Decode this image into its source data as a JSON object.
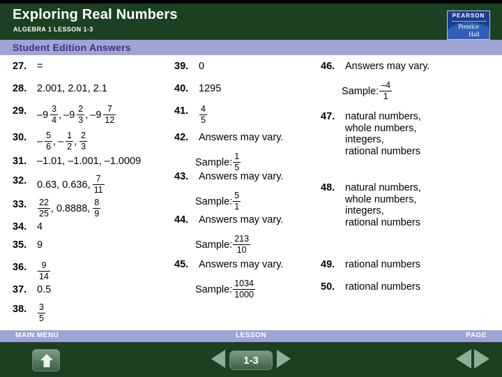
{
  "header": {
    "title": "Exploring Real Numbers",
    "subtitle": "ALGEBRA 1  LESSON 1-3",
    "logo": {
      "top_text": "PEARSON",
      "brand_line1": "Prentice",
      "brand_line2": "Hall",
      "bg_color": "#1b3f8f"
    },
    "bg_color": "#1d4023"
  },
  "band": {
    "label": "Student Edition Answers",
    "bg_color": "#9fa4d4",
    "text_color": "#4b2a8c"
  },
  "columns": [
    {
      "name": "column-1",
      "items": [
        {
          "num": "27.",
          "type": "text",
          "value": "="
        },
        {
          "num": "28.",
          "type": "text",
          "value": "2.001, 2.01, 2.1"
        },
        {
          "num": "29.",
          "type": "mixed-list",
          "parts": [
            {
              "whole": "–9",
              "n": "3",
              "d": "4",
              "sep": ","
            },
            {
              "whole": "–9",
              "n": "2",
              "d": "3",
              "sep": ","
            },
            {
              "whole": "–9",
              "n": "7",
              "d": "12",
              "sep": ""
            }
          ]
        },
        {
          "num": "30.",
          "type": "mixed-list",
          "parts": [
            {
              "whole": "–",
              "n": "5",
              "d": "6",
              "sep": ","
            },
            {
              "whole": "–",
              "n": "1",
              "d": "2",
              "sep": ","
            },
            {
              "whole": "",
              "n": "2",
              "d": "3",
              "sep": ""
            }
          ]
        },
        {
          "num": "31.",
          "type": "text",
          "value": "–1.01, –1.001, –1.0009"
        },
        {
          "num": "32.",
          "type": "mixed-list",
          "parts": [
            {
              "whole": "0.63, 0.636,",
              "n": "7",
              "d": "11",
              "sep": ""
            }
          ]
        },
        {
          "num": "33.",
          "type": "mixed-list",
          "parts": [
            {
              "whole": "",
              "n": "22",
              "d": "25",
              "sep": ", 0.8888,"
            },
            {
              "whole": "",
              "n": "8",
              "d": "9",
              "sep": ""
            }
          ]
        },
        {
          "num": "34.",
          "type": "text",
          "value": "4"
        },
        {
          "num": "35.",
          "type": "text",
          "value": "9"
        },
        {
          "num": "36.",
          "type": "mixed-list",
          "parts": [
            {
              "whole": "",
              "n": "9",
              "d": "14",
              "sep": ""
            }
          ]
        },
        {
          "num": "37.",
          "type": "text",
          "value": "0.5"
        },
        {
          "num": "38.",
          "type": "mixed-list",
          "parts": [
            {
              "whole": "",
              "n": "3",
              "d": "5",
              "sep": ""
            }
          ]
        }
      ]
    },
    {
      "name": "column-2",
      "items": [
        {
          "num": "39.",
          "type": "text",
          "value": "0"
        },
        {
          "num": "40.",
          "type": "text",
          "value": "1295"
        },
        {
          "num": "41.",
          "type": "mixed-list",
          "parts": [
            {
              "whole": "",
              "n": "4",
              "d": "5",
              "sep": ""
            }
          ]
        },
        {
          "num": "42.",
          "type": "text",
          "value": "Answers may vary.",
          "sample": {
            "label": "Sample:",
            "n": "1",
            "d": "5"
          }
        },
        {
          "num": "43.",
          "type": "text",
          "value": "Answers may vary.",
          "sample": {
            "label": "Sample:",
            "n": "5",
            "d": "1"
          }
        },
        {
          "num": "44.",
          "type": "text",
          "value": "Answers may vary.",
          "sample": {
            "label": "Sample:",
            "n": "213",
            "d": "10"
          }
        },
        {
          "num": "45.",
          "type": "text",
          "value": "Answers may vary.",
          "sample": {
            "label": "Sample:",
            "n": "1034",
            "d": "1000"
          }
        }
      ]
    },
    {
      "name": "column-3",
      "items": [
        {
          "num": "46.",
          "type": "text",
          "value": "Answers may vary.",
          "sample": {
            "label": "Sample:",
            "n": "–4",
            "d": "1"
          }
        },
        {
          "num": "47.",
          "type": "multiline",
          "value": "natural numbers,\nwhole numbers,\nintegers,\nrational numbers"
        },
        {
          "num": "48.",
          "type": "multiline",
          "value": "natural numbers,\nwhole numbers,\nintegers,\nrational numbers"
        },
        {
          "num": "49.",
          "type": "text",
          "value": "rational numbers"
        },
        {
          "num": "50.",
          "type": "text",
          "value": "rational numbers"
        }
      ]
    }
  ],
  "footer": {
    "bg_color": "#1d4023",
    "bar_color": "#9fa4d4",
    "main_menu_label": "MAIN MENU",
    "lesson_label": "LESSON",
    "page_label": "PAGE",
    "lesson_number": "1-3",
    "home_icon": "home-up-arrow-icon",
    "prev_icon": "left-triangle-icon",
    "next_icon": "right-triangle-icon"
  }
}
